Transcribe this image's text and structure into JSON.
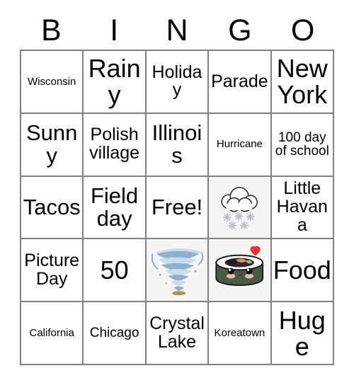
{
  "header": {
    "letters": [
      "B",
      "I",
      "N",
      "G",
      "O"
    ]
  },
  "grid": {
    "rows": [
      [
        {
          "text": "Wisconsin",
          "size": "xs",
          "type": "text"
        },
        {
          "text": "Rainy",
          "size": "xl",
          "type": "text"
        },
        {
          "text": "Holiday",
          "size": "md",
          "type": "text"
        },
        {
          "text": "Parade",
          "size": "md",
          "type": "text"
        },
        {
          "text": "New York",
          "size": "xl",
          "type": "text"
        }
      ],
      [
        {
          "text": "Sunny",
          "size": "lg",
          "type": "text"
        },
        {
          "text": "Polish village",
          "size": "md",
          "type": "text"
        },
        {
          "text": "Illinois",
          "size": "lg",
          "type": "text"
        },
        {
          "text": "Hurricane",
          "size": "xs",
          "type": "text"
        },
        {
          "text": "100 day of school",
          "size": "sm",
          "type": "text"
        }
      ],
      [
        {
          "text": "Tacos",
          "size": "lg",
          "type": "text"
        },
        {
          "text": "Field day",
          "size": "lg",
          "type": "text"
        },
        {
          "text": "Free!",
          "size": "lg",
          "type": "text"
        },
        {
          "text": "",
          "size": "md",
          "type": "image",
          "icon": "snow-cloud-icon"
        },
        {
          "text": "Little Havana",
          "size": "md",
          "type": "text"
        }
      ],
      [
        {
          "text": "Picture Day",
          "size": "md",
          "type": "text"
        },
        {
          "text": "50",
          "size": "xl",
          "type": "text"
        },
        {
          "text": "",
          "size": "md",
          "type": "image",
          "icon": "tornado-icon"
        },
        {
          "text": "",
          "size": "md",
          "type": "image",
          "icon": "sushi-icon"
        },
        {
          "text": "Food",
          "size": "xl",
          "type": "text"
        }
      ],
      [
        {
          "text": "California",
          "size": "xs",
          "type": "text"
        },
        {
          "text": "Chicago",
          "size": "sm",
          "type": "text"
        },
        {
          "text": "Crystal Lake",
          "size": "md",
          "type": "text"
        },
        {
          "text": "Koreatown",
          "size": "xs",
          "type": "text"
        },
        {
          "text": "Huge",
          "size": "xl",
          "type": "text"
        }
      ]
    ]
  },
  "colors": {
    "border": "#808080",
    "background": "#ffffff",
    "text": "#000000",
    "image_cell_background": "#f5f5f5",
    "tornado_blue": "#8fb0cc",
    "tornado_light": "#c8dceb",
    "tornado_debris": "#c08a4a",
    "sushi_nori": "#4b5a45",
    "sushi_rice": "#ffffff",
    "sushi_salmon": "#e8926a",
    "sushi_avocado": "#8fc65a",
    "sushi_blush": "#e9b7b0",
    "sushi_mouth": "#e8332a",
    "heart_red": "#e8332a",
    "snowflake_gray": "#b9bcc4"
  }
}
